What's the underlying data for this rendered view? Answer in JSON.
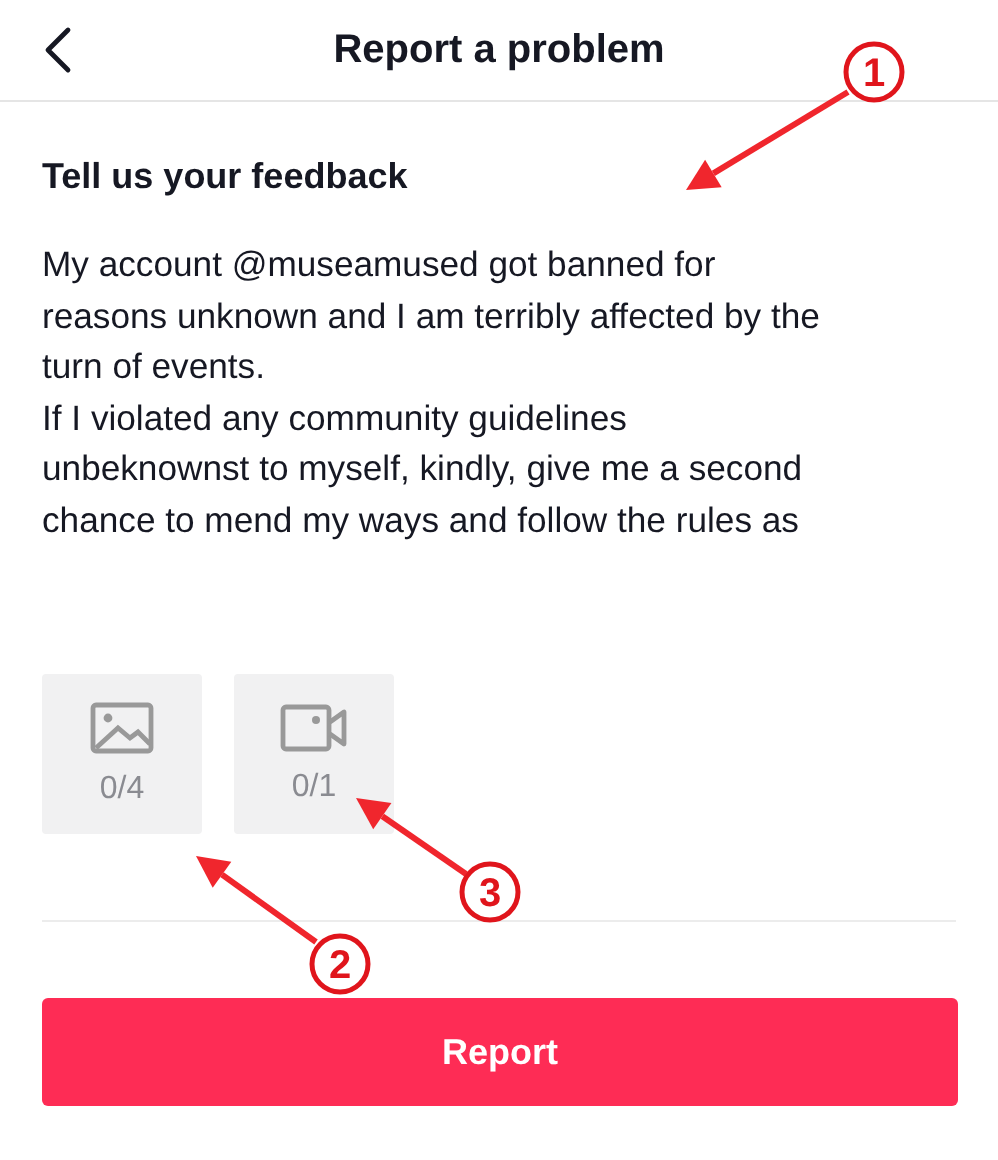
{
  "header": {
    "title": "Report a problem"
  },
  "feedback": {
    "label": "Tell us your feedback",
    "value": "My account @museamused got banned for\nreasons unknown and I am terribly affected by the\nturn of events.\nIf I violated any community guidelines\nunbeknownst to myself, kindly, give me a second\nchance to mend my ways and follow the rules as"
  },
  "attachments": [
    {
      "kind": "image",
      "count": "0/4"
    },
    {
      "kind": "video",
      "count": "0/1"
    }
  ],
  "submit_button": "Report",
  "annotations": [
    {
      "label": "1"
    },
    {
      "label": "2"
    },
    {
      "label": "3"
    }
  ]
}
